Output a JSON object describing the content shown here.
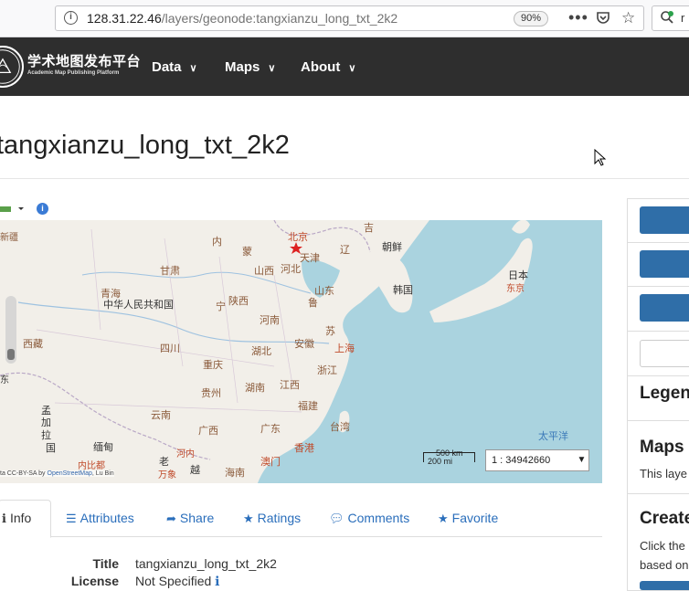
{
  "browser": {
    "url_host": "128.31.22.46",
    "url_path": "/layers/geonode:tangxianzu_long_txt_2k2",
    "zoom": "90%",
    "search_text": "r"
  },
  "navbar": {
    "logo_title": "学术地图发布平台",
    "logo_subtitle": "Academic Map Publishing Platform",
    "items": [
      {
        "label": "Data"
      },
      {
        "label": "Maps"
      },
      {
        "label": "About"
      }
    ]
  },
  "page": {
    "title": "tangxianzu_long_txt_2k2"
  },
  "map": {
    "scale_km": "500 km",
    "scale_mi": "200 mi",
    "scale_value": "1 : 34942660",
    "attribution_prefix": "ta CC-BY-SA by ",
    "attribution_link": "OpenStreetMap",
    "attribution_suffix": ", Lu Bin",
    "labels": {
      "beijing": "北京",
      "tianjin": "天津",
      "china": "中华人民共和国",
      "korea_n": "朝鲜",
      "korea_s": "韩国",
      "japan": "日本",
      "tokyo": "东京",
      "qinghai": "青海",
      "sichuan": "四川",
      "hubei": "湖北",
      "hunan": "湖南",
      "henan": "河南",
      "shandong": "山东",
      "hebei": "河北",
      "shanxi": "山西",
      "shaanxi": "陕西",
      "gansu": "甘肃",
      "ningxia": "宁",
      "inner": "内",
      "neimeng": "蒙",
      "anhui": "安徽",
      "jiangsu": "苏",
      "shanghai": "上海",
      "zhejiang": "浙江",
      "jiangxi": "江西",
      "fujian": "福建",
      "taiwan": "台湾",
      "guangdong": "广东",
      "guangxi": "广西",
      "guizhou": "贵州",
      "yunnan": "云南",
      "chongqing": "重庆",
      "hongkong": "香港",
      "macau": "澳门",
      "hainan": "海南",
      "tibet": "西藏",
      "myanmar": "缅甸",
      "bangla_1": "孟",
      "bangla_2": "加",
      "bangla_3": "拉",
      "bangla_4": "国",
      "laos": "老",
      "vietnam": "越",
      "hanoi": "河内",
      "naypyidaw": "内比都",
      "vientiane": "万象",
      "pacific": "太平洋",
      "xinjiang": "新疆",
      "east": "东",
      "liao": "辽",
      "ji": "吉",
      "lu": "鲁"
    }
  },
  "tabs": [
    {
      "icon": "info-icon",
      "label": "Info"
    },
    {
      "icon": "list-icon",
      "label": "Attributes"
    },
    {
      "icon": "share-icon",
      "label": "Share"
    },
    {
      "icon": "star-icon",
      "label": "Ratings"
    },
    {
      "icon": "comment-icon",
      "label": "Comments"
    },
    {
      "icon": "star-icon",
      "label": "Favorite"
    }
  ],
  "info": {
    "rows": [
      {
        "key": "Title",
        "value": "tangxianzu_long_txt_2k2"
      },
      {
        "key": "License",
        "value": "Not Specified"
      }
    ]
  },
  "sidebar": {
    "legend": "Legend",
    "maps_using": "Maps u",
    "maps_using_text": "This laye",
    "create": "Create",
    "create_text_1": "Click the",
    "create_text_2": "based on"
  },
  "colors": {
    "navbar": "#2e2e2e",
    "link": "#2a6ebb",
    "button": "#2f6ea8",
    "sea": "#aad3df",
    "land": "#f2efe9"
  }
}
